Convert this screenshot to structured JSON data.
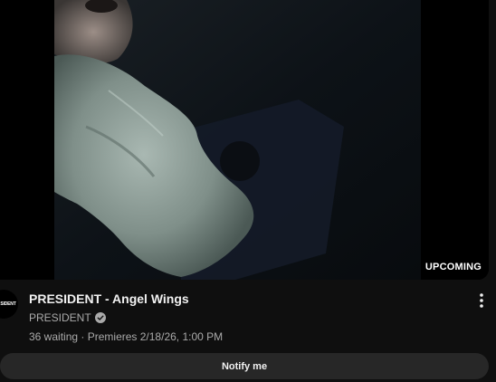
{
  "video": {
    "title": "PRESIDENT - Angel Wings",
    "badge": "UPCOMING",
    "waiting": "36 waiting",
    "separator": "·",
    "premiere": "Premieres 2/18/26, 1:00 PM"
  },
  "channel": {
    "name": "PRESIDENT",
    "avatar_text": "SIDENT",
    "verified_icon": "verified-check-icon"
  },
  "actions": {
    "more_icon": "more-vertical-icon",
    "notify_label": "Notify me"
  },
  "colors": {
    "background": "#0f0f0f",
    "text_primary": "#f1f1f1",
    "text_secondary": "#aaaaaa",
    "button_bg": "#272727"
  }
}
